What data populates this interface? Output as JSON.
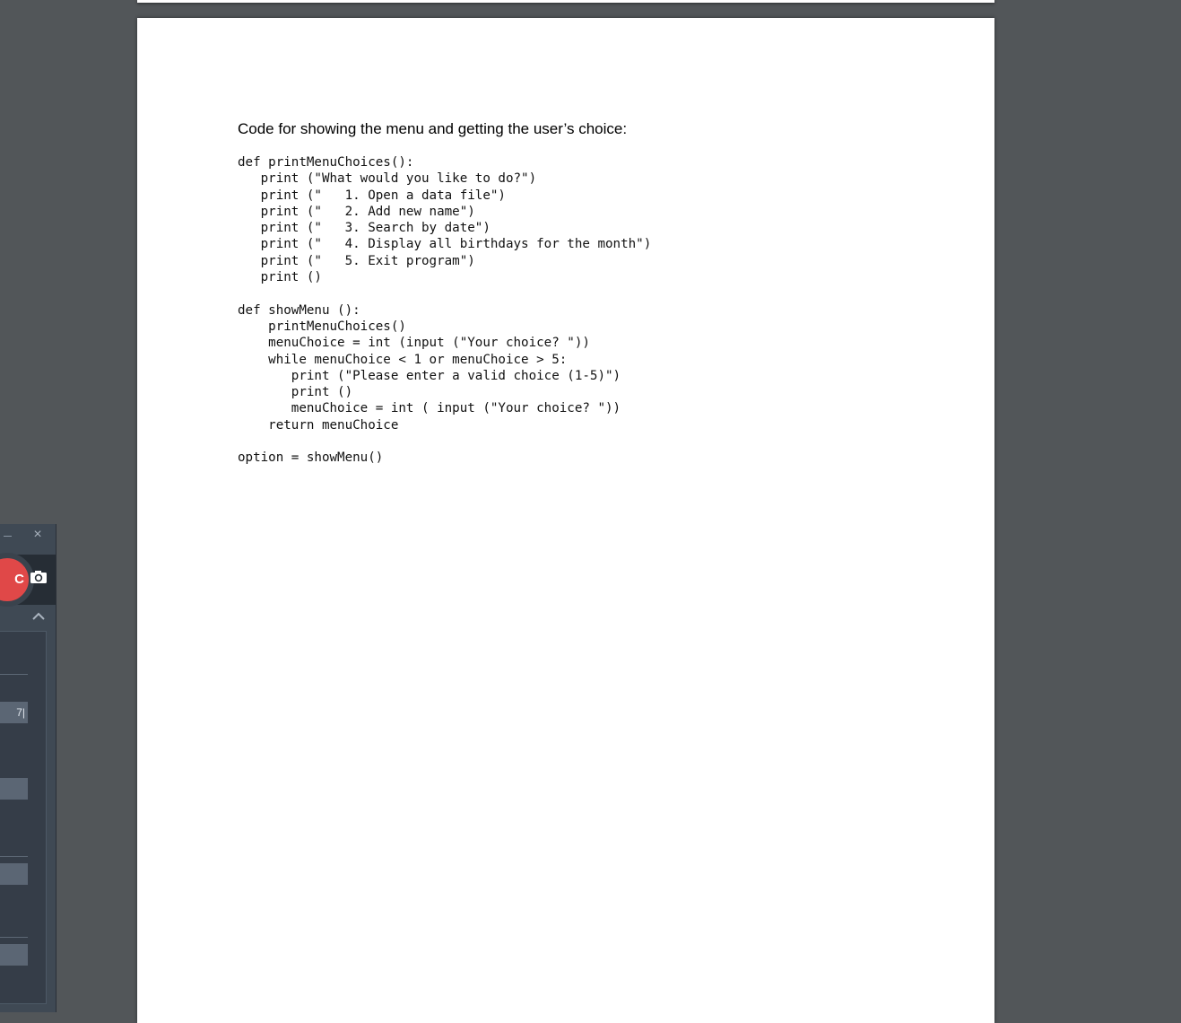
{
  "document": {
    "heading": "Code for showing the menu and getting the user’s choice:",
    "code_lines": [
      "def printMenuChoices():",
      "   print (\"What would you like to do?\")",
      "   print (\"   1. Open a data file\")",
      "   print (\"   2. Add new name\")",
      "   print (\"   3. Search by date\")",
      "   print (\"   4. Display all birthdays for the month\")",
      "   print (\"   5. Exit program\")",
      "   print ()",
      "",
      "def showMenu ():",
      "    printMenuChoices()",
      "    menuChoice = int (input (\"Your choice? \"))",
      "    while menuChoice < 1 or menuChoice > 5:",
      "       print (\"Please enter a valid choice (1-5)\")",
      "       print ()",
      "       menuChoice = int ( input (\"Your choice? \"))",
      "    return menuChoice",
      "",
      "option = showMenu()"
    ]
  },
  "recorder": {
    "close_icon": "×",
    "record_label": "C",
    "field_1_value": "7|",
    "icons": [
      "minimize-icon",
      "close-icon",
      "record-icon",
      "camera-icon",
      "chevron-up-icon"
    ],
    "colors": {
      "record": "#e04848",
      "panel": "#353d48",
      "field": "#5b6674"
    }
  }
}
